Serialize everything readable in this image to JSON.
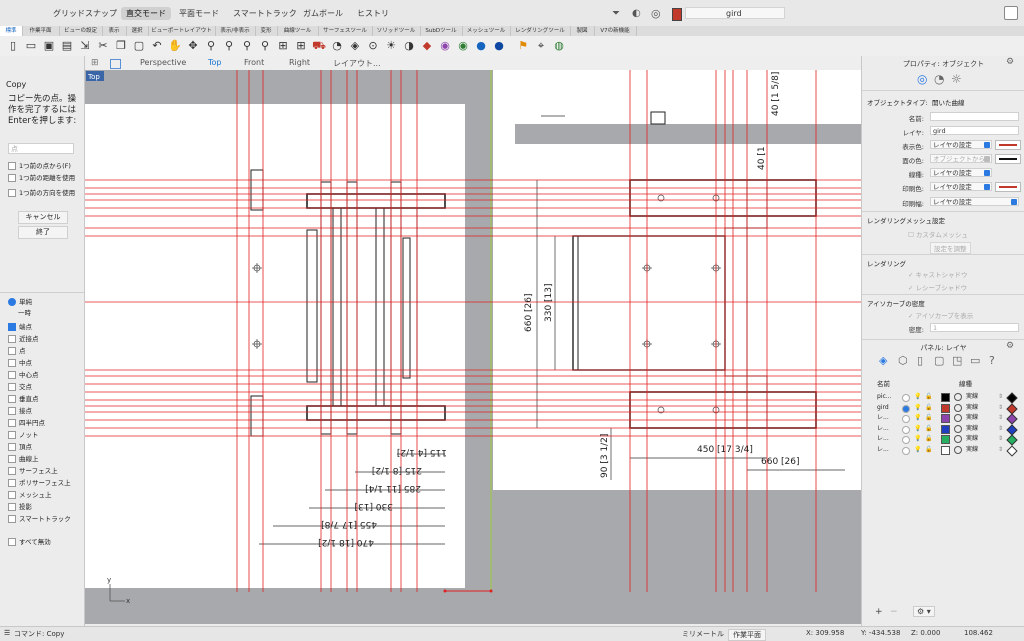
{
  "topbar": {
    "modes": [
      "グリッドスナップ",
      "直交モード",
      "平面モード",
      "スマートトラック",
      "ガムボール",
      "ヒストリ"
    ],
    "active_mode": "直交モード",
    "current_layer": "gird",
    "layer_color": "#c0392b"
  },
  "tabs": [
    "標準",
    "作業平面",
    "ビューの設定",
    "表示",
    "選択",
    "ビューポートレイアウト",
    "表示/非表示",
    "変形",
    "曲線ツール",
    "サーフェスツール",
    "ソリッドツール",
    "SubDツール",
    "メッシュツール",
    "レンダリングツール",
    "製図",
    "V7の新機能"
  ],
  "toolbar_icons": [
    "new-file-icon",
    "open-file-icon",
    "save-icon",
    "print-icon",
    "import-icon",
    "cut-icon",
    "copy-icon",
    "paste-icon",
    "undo-icon",
    "hand-pan-icon",
    "rotate-view-icon",
    "zoom-icon",
    "zoom-window-icon",
    "zoom-extents-icon",
    "zoom-selected-icon",
    "four-views-icon",
    "car-icon",
    "camera-icon",
    "cplane-icon",
    "select-point-icon",
    "lightbulb-icon",
    "shade-icon",
    "erase-icon",
    "material-icon",
    "sphere-icon",
    "render-icon",
    "flag-icon",
    "measure-icon",
    "globe-icon"
  ],
  "left_panel": {
    "command_title": "Copy",
    "prompt": "コピー先の点。操作を完了するにはEnterを押します:",
    "point_placeholder": "点",
    "options": [
      "1つ前の点から(F)",
      "1つ前の距離を使用",
      "1つ前の方向を使用"
    ],
    "cancel": "キャンセル",
    "finish": "終了",
    "snap_mode": [
      "単純",
      "一時"
    ],
    "osnaps": [
      {
        "label": "端点",
        "checked": true
      },
      {
        "label": "近接点",
        "checked": false
      },
      {
        "label": "点",
        "checked": false
      },
      {
        "label": "中点",
        "checked": false
      },
      {
        "label": "中心点",
        "checked": false
      },
      {
        "label": "交点",
        "checked": false
      },
      {
        "label": "垂直点",
        "checked": false
      },
      {
        "label": "接点",
        "checked": false
      },
      {
        "label": "四半円点",
        "checked": false
      },
      {
        "label": "ノット",
        "checked": false
      },
      {
        "label": "頂点",
        "checked": false
      },
      {
        "label": "曲線上",
        "checked": false
      },
      {
        "label": "サーフェス上",
        "checked": false
      },
      {
        "label": "ポリサーフェス上",
        "checked": false
      },
      {
        "label": "メッシュ上",
        "checked": false
      },
      {
        "label": "投影",
        "checked": false
      },
      {
        "label": "スマートトラック",
        "checked": false
      }
    ],
    "disable_all": "すべて無効"
  },
  "viewport": {
    "tabs": [
      "Perspective",
      "Top",
      "Front",
      "Right",
      "レイアウト..."
    ],
    "active_tab": "Top",
    "label": "Top",
    "axis_x": "x",
    "axis_y": "y",
    "dims": {
      "d115": "115 [4 1/2]",
      "d215": "215 [8 1/2]",
      "d285": "285 [11 1/4]",
      "d330": "330 [13]",
      "d455": "455 [17 7/8]",
      "d470": "470 [18 1/2]",
      "d660": "660 [26]",
      "d330v": "330 [13]",
      "d40a": "40 [1 5/8]",
      "d40b": "40 [1",
      "d90": "90 [3 1/2]",
      "d450": "450 [17 3/4]",
      "d660b": "660 [26]"
    }
  },
  "properties": {
    "header": "プロパティ: オブジェクト",
    "object_type_label": "オブジェクトタイプ:",
    "object_type": "開いた曲線",
    "name_label": "名前:",
    "layer_label": "レイヤ:",
    "layer_value": "gird",
    "display_color_label": "表示色:",
    "display_color": "レイヤの設定",
    "material_color_label": "面の色:",
    "material_color": "オブジェクトから",
    "linetype_label": "線種:",
    "linetype": "レイヤの設定",
    "print_color_label": "印刷色:",
    "print_color": "レイヤの設定",
    "print_width_label": "印刷幅:",
    "print_width": "レイヤの設定",
    "mesh_section": "レンダリングメッシュ設定",
    "custom_mesh": "カスタムメッシュ",
    "adjust_settings": "設定を調整",
    "render_section": "レンダリング",
    "cast_shadows": "キャストシャドウ",
    "receive_shadows": "レシーブシャドウ",
    "isocurve_section": "アイソカーブの密度",
    "show_isocurves": "アイソカーブを表示",
    "density_label": "密度:",
    "density_value": "1"
  },
  "layers_panel": {
    "header": "パネル: レイヤ",
    "col_name": "名前",
    "col_linetype": "線種",
    "rows": [
      {
        "name": "pic...",
        "color": "#000000",
        "linetype": "実線",
        "print": "#000000"
      },
      {
        "name": "gird",
        "color": "#c0392b",
        "linetype": "実線",
        "print": "#c0392b"
      },
      {
        "name": "レ...",
        "color": "#8e44ad",
        "linetype": "実線",
        "print": "#8e44ad"
      },
      {
        "name": "レ...",
        "color": "#1f3fbf",
        "linetype": "実線",
        "print": "#1f3fbf"
      },
      {
        "name": "レ...",
        "color": "#27ae60",
        "linetype": "実線",
        "print": "#27ae60"
      },
      {
        "name": "レ...",
        "color": "#ffffff",
        "linetype": "実線",
        "print": "#ffffff"
      }
    ]
  },
  "status": {
    "command": "コマンド: Copy",
    "units": "ミリメートル",
    "cplane": "作業平面",
    "x": "X: 309.958",
    "y": "Y: -434.538",
    "z": "Z: 0.000",
    "extra": "108.462"
  }
}
